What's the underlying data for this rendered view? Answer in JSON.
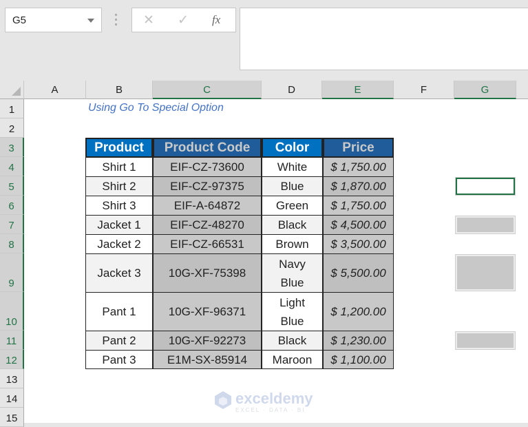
{
  "formula_bar": {
    "name_box": "G5",
    "cancel_icon": "✕",
    "enter_icon": "✓",
    "fx_label": "fx",
    "formula_value": ""
  },
  "columns": [
    "A",
    "B",
    "C",
    "D",
    "E",
    "F",
    "G"
  ],
  "selected_columns": [
    "C",
    "E",
    "G"
  ],
  "rows": [
    "1",
    "2",
    "3",
    "4",
    "5",
    "6",
    "7",
    "8",
    "9",
    "10",
    "11",
    "12",
    "13",
    "14",
    "15"
  ],
  "selected_rows": [
    "3",
    "4",
    "5",
    "6",
    "7",
    "8",
    "9",
    "10",
    "11",
    "12"
  ],
  "sheet": {
    "title": "Using Go To Special Option",
    "table": {
      "headers": [
        "Product",
        "Product Code",
        "Color",
        "Price"
      ],
      "rows": [
        {
          "product": "Shirt 1",
          "code": "EIF-CZ-73600",
          "color": "White",
          "price": "$ 1,750.00"
        },
        {
          "product": "Shirt 2",
          "code": "EIF-CZ-97375",
          "color": "Blue",
          "price": "$ 1,870.00"
        },
        {
          "product": "Shirt 3",
          "code": "EIF-A-64872",
          "color": "Green",
          "price": "$ 1,750.00"
        },
        {
          "product": "Jacket 1",
          "code": "EIF-CZ-48270",
          "color": "Black",
          "price": "$ 4,500.00"
        },
        {
          "product": "Jacket 2",
          "code": "EIF-CZ-66531",
          "color": "Brown",
          "price": "$ 3,500.00"
        },
        {
          "product": "Jacket 3",
          "code": "10G-XF-75398",
          "color": "Navy Blue",
          "price": "$ 5,500.00"
        },
        {
          "product": "Pant 1",
          "code": "10G-XF-96371",
          "color": "Light Blue",
          "price": "$ 1,200.00"
        },
        {
          "product": "Pant 2",
          "code": "10G-XF-92273",
          "color": "Black",
          "price": "$ 1,230.00"
        },
        {
          "product": "Pant 3",
          "code": "E1M-SX-85914",
          "color": "Maroon",
          "price": "$ 1,100.00"
        }
      ]
    },
    "active_cell": "G5",
    "selected_cells_G": [
      "G5",
      "G7",
      "G9",
      "G11"
    ]
  },
  "colors": {
    "header_blue": "#0070c0",
    "header_selected": "#1f5c99",
    "selection_gray": "#c8c8c8",
    "excel_green": "#217346",
    "title_blue": "#4472c4"
  },
  "watermark": {
    "name": "exceldemy",
    "tagline": "EXCEL · DATA · BI"
  }
}
